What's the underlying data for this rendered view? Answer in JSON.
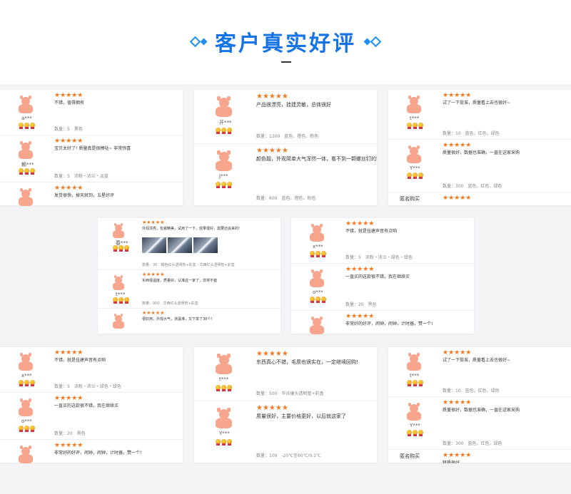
{
  "header": {
    "title": "客户真实好评"
  },
  "stars": "★★★★★",
  "cards": [
    {
      "id": "c1",
      "rows": [
        {
          "user": "a***",
          "text": "不错，值得拥有",
          "meta": "数量：5　黑色"
        },
        {
          "user": "赖***",
          "text": "宝贝太好了! 质量真是很棒哒~ 非常惊喜",
          "meta": "数量：5　浓粉・浓兰・淡蓝"
        },
        {
          "user": "",
          "text": "发货很快，掉天就到，五星好评",
          "meta": ""
        }
      ]
    },
    {
      "id": "c2",
      "rows": [
        {
          "user": "开***",
          "text": "产品很漂亮，挂建灵敏，总体很好",
          "meta": "数量：1200　蓝色、橙色、粉色"
        },
        {
          "user": "J***",
          "text": "颜色靓，外观简单大气浑然一体，看不到一颗螺丝钉的影子，还送两",
          "meta": "数量：600　蓝色、橙色、粉色"
        }
      ]
    },
    {
      "id": "c3",
      "rows": [
        {
          "user": "t***",
          "text": "试了一下挺准，质量看上去也很好~",
          "meta": "数量：10　蓝色，红色，绿色"
        },
        {
          "user": "Y***",
          "text": "质量很好，数据也准确，一直在这家采购",
          "meta": "数量：300　蓝色，红色，绿色"
        },
        {
          "user": "匿名购买",
          "text": "",
          "meta": ""
        }
      ]
    },
    {
      "id": "c4",
      "rows": [
        {
          "user": "春***",
          "text": "外观漂亮，包装精美，试用了一下，效果很好，需要还会来的!",
          "meta": "数量：30　橘色红头透明管+彩盒・华西红头透明管+彩盒"
        },
        {
          "user": "t***",
          "text": "东西很温度，质量好，认准这一家了，非常不错",
          "meta": "数量：900　华西红头透明管+彩盒"
        },
        {
          "user": "",
          "text": "很好用，外观大气，测温准，又下单了30个!",
          "meta": ""
        }
      ]
    },
    {
      "id": "c5",
      "rows": [
        {
          "user": "x***",
          "text": "不错，就是挂建声音有点响",
          "meta": "数量：5　浓粉・浓兰・绿色・绿色"
        },
        {
          "user": "o***",
          "text": "一直买的这款很不错，我在继续买",
          "meta": "数量：20　黑色"
        },
        {
          "user": "",
          "text": "非常好的好评，闹钟，闹钟，计时器，赞一个!",
          "meta": ""
        }
      ]
    },
    {
      "id": "c6",
      "rows": [
        {
          "user": "x***",
          "text": "不错，就是挂建声音有点响",
          "meta": "数量：5　浓粉・浓兰・绿色・绿色"
        },
        {
          "user": "o***",
          "text": "一直买的这款很不错，我在继续买",
          "meta": "数量：20　黑色"
        },
        {
          "user": "",
          "text": "非常好的好评，闹钟，闹钟，计时器，赞一个!",
          "meta": ""
        }
      ]
    },
    {
      "id": "c7",
      "rows": [
        {
          "user": "t***",
          "text": "东西真心不错，毛质也很实在，一定继续回购!",
          "meta": "数量：500　华兵硬头透明管+彩盒"
        },
        {
          "user": "Y***",
          "text": "质量很好，主要价格更好，以后就这家了",
          "meta": "数量：100　-20℃至60℃/0.1℃"
        }
      ]
    },
    {
      "id": "c8",
      "rows": [
        {
          "user": "t***",
          "text": "试了一下挺准，质量看上去也很好~",
          "meta": "数量：10　蓝色，红色，绿色"
        },
        {
          "user": "Y***",
          "text": "质量很好，数据也准确，一直在这家采购",
          "meta": "数量：300　蓝色，红色，绿色"
        },
        {
          "user": "匿名购买",
          "text": "特质很好",
          "meta": ""
        }
      ]
    }
  ]
}
